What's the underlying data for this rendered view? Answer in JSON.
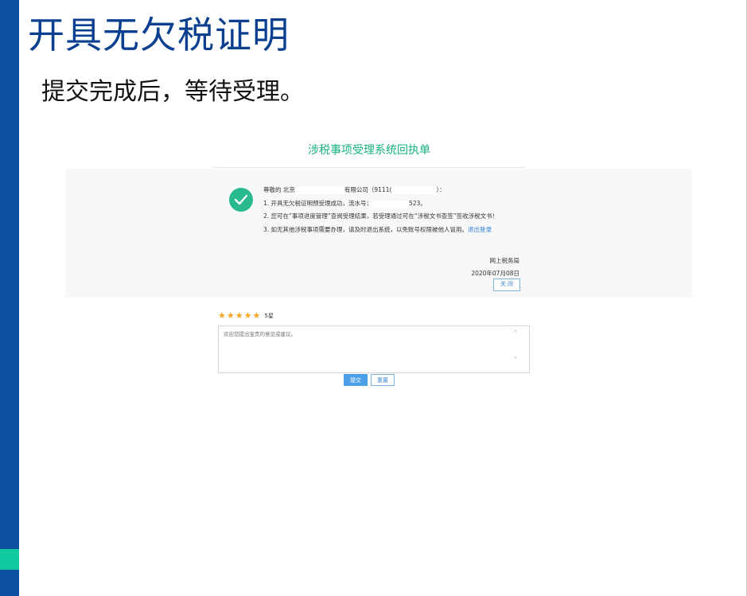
{
  "slide": {
    "title": "开具无欠税证明",
    "subtitle": "提交完成后，等待受理。"
  },
  "receipt": {
    "title": "涉税事项受理系统回执单",
    "greeting_prefix": "尊敬的 北京",
    "greeting_middle": "有限公司（9111(",
    "greeting_suffix": "）：",
    "line1_prefix": "1. 开具无欠税证明预受理成功，流水号：",
    "line1_suffix": "523。",
    "line2": "2. 您可在“事项进度管理”查阅受理结果，若受理通过可在“涉税文书查签”签收涉税文书！",
    "line3_prefix": "3. 如无其他涉税事项需要办理，请及时退出系统，以免账号权限被他人冒用。",
    "logout_link": "退出登录",
    "org": "网上税务局",
    "date": "2020年07月08日",
    "close_label": "关 闭"
  },
  "rating": {
    "stars": 5,
    "star_glyph": "★",
    "label": "5星"
  },
  "feedback": {
    "placeholder": "欢迎您提出宝贵的意见或建议。"
  },
  "actions": {
    "submit_label": "提交",
    "reset_label": "重置"
  },
  "colors": {
    "sidebar": "#0b4fa0",
    "accent": "#10c9a0",
    "title": "#0b3f8f",
    "success": "#29b98f"
  }
}
